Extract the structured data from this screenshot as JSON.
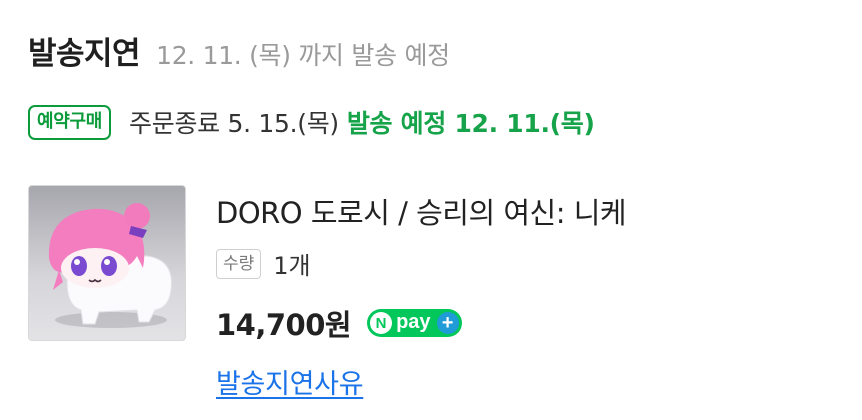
{
  "shipping_status": {
    "title": "발송지연",
    "note": "12. 11. (목) 까지 발송 예정"
  },
  "order": {
    "badge": "예약구매",
    "order_end": "주문종료 5. 15.(목)",
    "ship_date": "발송 예정 12. 11.(목)"
  },
  "product": {
    "name": "DORO 도로시 / 승리의 여신: 니케",
    "quantity_label": "수량",
    "quantity_value": "1개",
    "price": "14,700원"
  },
  "npay": {
    "n": "N",
    "text": "pay",
    "plus": "+"
  },
  "links": {
    "delay_reason": "발송지연사유"
  },
  "colors": {
    "accent_green": "#16a34a",
    "badge_green": "#0b9b3b",
    "npay_green": "#03c75a",
    "npay_plus_blue": "#1f9bd8",
    "link_blue": "#1a73e8"
  },
  "icons": {
    "thumbnail": "product-figure-thumbnail",
    "npay": "npay-plus-logo"
  }
}
